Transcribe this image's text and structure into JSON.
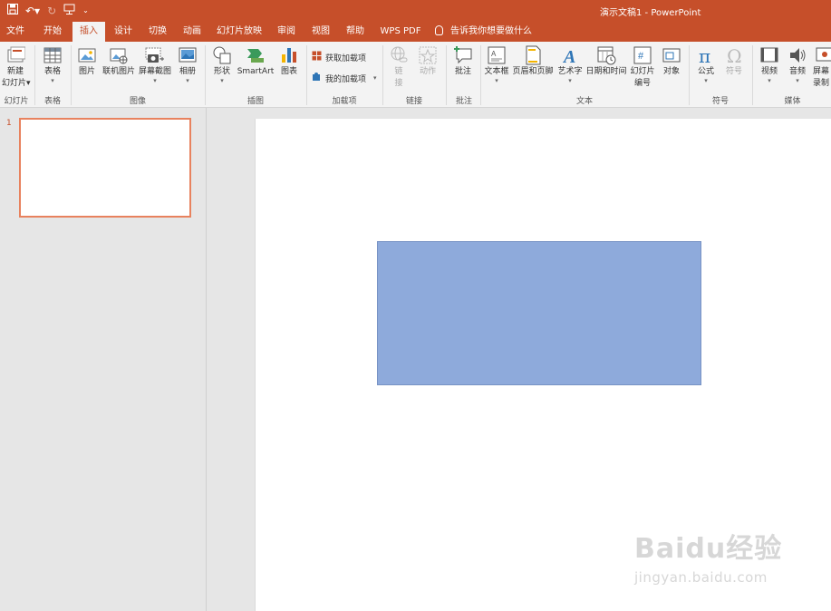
{
  "app": {
    "title": "演示文稿1  -  PowerPoint"
  },
  "quick_access": {
    "save": "save-icon",
    "undo": "undo-icon",
    "redo": "redo-icon",
    "present": "present-icon",
    "customize": "customize-icon"
  },
  "tabs": [
    "文件",
    "开始",
    "插入",
    "设计",
    "切换",
    "动画",
    "幻灯片放映",
    "审阅",
    "视图",
    "帮助",
    "WPS PDF"
  ],
  "active_tab": "插入",
  "tell_me": "告诉我你想要做什么",
  "ribbon": {
    "groups": [
      "幻灯片",
      "表格",
      "图像",
      "插图",
      "加载项",
      "链接",
      "批注",
      "文本",
      "符号",
      "媒体"
    ],
    "buttons": {
      "new_slide": "新建",
      "new_slide_2": "幻灯片",
      "table": "表格",
      "picture": "图片",
      "online_picture": "联机图片",
      "screenshot": "屏幕截图",
      "album": "相册",
      "shapes": "形状",
      "smartart": "SmartArt",
      "chart": "图表",
      "get_addins": "获取加载项",
      "my_addins": "我的加载项",
      "link": "链",
      "link_2": "接",
      "action": "动作",
      "comment": "批注",
      "textbox": "文本框",
      "header_footer": "页眉和页脚",
      "wordart": "艺术字",
      "datetime": "日期和时间",
      "slide_number": "幻灯片",
      "slide_number_2": "编号",
      "object": "对象",
      "equation": "公式",
      "symbol": "符号",
      "video": "视频",
      "audio": "音频",
      "screen_rec": "屏幕",
      "screen_rec_2": "录制"
    }
  },
  "slides": {
    "number": "1"
  },
  "shape": {
    "fill": "#8eaadb",
    "border": "#7792c4"
  },
  "colors": {
    "accent": "#c64f2a",
    "selected": "#e8825e"
  },
  "watermark": {
    "line1": "Baidu经验",
    "line2": "jingyan.baidu.com"
  }
}
